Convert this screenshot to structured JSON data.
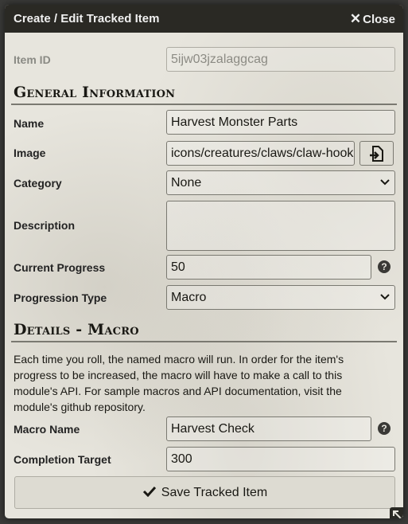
{
  "dialog": {
    "title": "Create / Edit Tracked Item",
    "close_label": "Close",
    "close_icon": "times-icon"
  },
  "fields": {
    "item_id": {
      "label": "Item ID",
      "value": "5ijw03jzalaggcag"
    },
    "name": {
      "label": "Name",
      "value": "Harvest Monster Parts"
    },
    "image": {
      "label": "Image",
      "value": "icons/creatures/claws/claw-hooked-curved.webp"
    },
    "category": {
      "label": "Category",
      "value": "None"
    },
    "description": {
      "label": "Description",
      "value": ""
    },
    "current_progress": {
      "label": "Current Progress",
      "value": "50"
    },
    "progression_type": {
      "label": "Progression Type",
      "value": "Macro"
    },
    "macro_name": {
      "label": "Macro Name",
      "value": "Harvest Check"
    },
    "completion_target": {
      "label": "Completion Target",
      "value": "300"
    }
  },
  "sections": {
    "general": "General Information",
    "details": "Details - Macro",
    "notes": "Each time you roll, the named macro will run. In order for the item's progress to be increased, the macro will have to make a call to this module's API. For sample macros and API documentation, visit the module's github repository."
  },
  "save_button": {
    "label": "Save Tracked Item",
    "icon": "check-icon"
  },
  "help_glyph": "?"
}
